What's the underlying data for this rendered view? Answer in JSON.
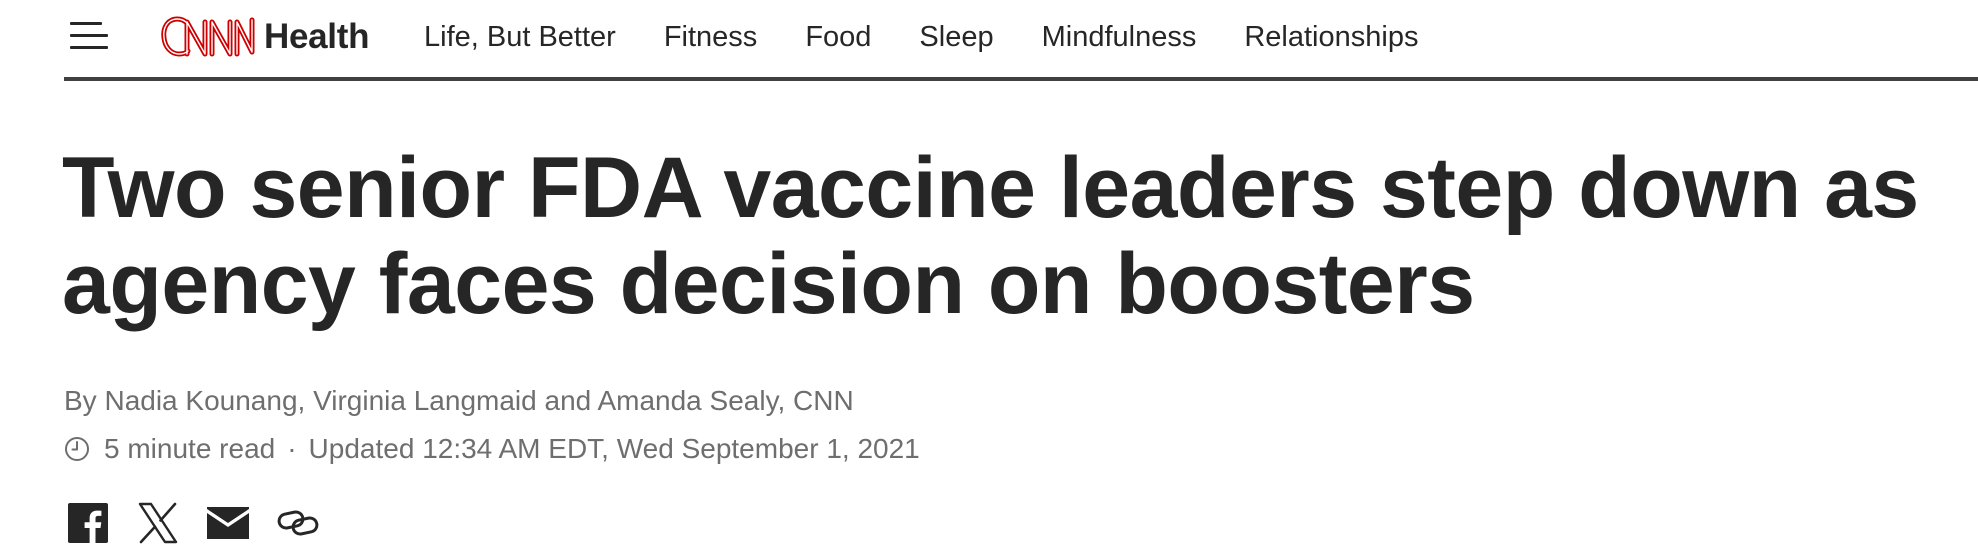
{
  "header": {
    "logo": {
      "brand": "CNN",
      "section": "Health",
      "brand_color": "#cc0000"
    },
    "nav_items": [
      {
        "label": "Life, But Better"
      },
      {
        "label": "Fitness"
      },
      {
        "label": "Food"
      },
      {
        "label": "Sleep"
      },
      {
        "label": "Mindfulness"
      },
      {
        "label": "Relationships"
      }
    ]
  },
  "article": {
    "headline_line1": "Two senior FDA vaccine leaders step down as",
    "headline_line2": "agency faces decision on boosters",
    "byline_prefix": "By ",
    "authors": [
      {
        "name": "Nadia Kounang"
      },
      {
        "name": "Virginia Langmaid"
      },
      {
        "name": "Amanda Sealy"
      }
    ],
    "byline_sep1": ", ",
    "byline_sep2": " and ",
    "byline_suffix": ", CNN",
    "read_time": "5 minute read",
    "meta_separator": "·",
    "updated": "Updated 12:34 AM EDT, Wed September 1, 2021"
  },
  "share": {
    "buttons": [
      {
        "icon": "facebook-icon"
      },
      {
        "icon": "x-icon"
      },
      {
        "icon": "email-icon"
      },
      {
        "icon": "link-icon"
      }
    ]
  },
  "colors": {
    "text": "#262626",
    "muted": "#6e6e6e",
    "rule": "#404040",
    "brand_red": "#cc0000"
  }
}
